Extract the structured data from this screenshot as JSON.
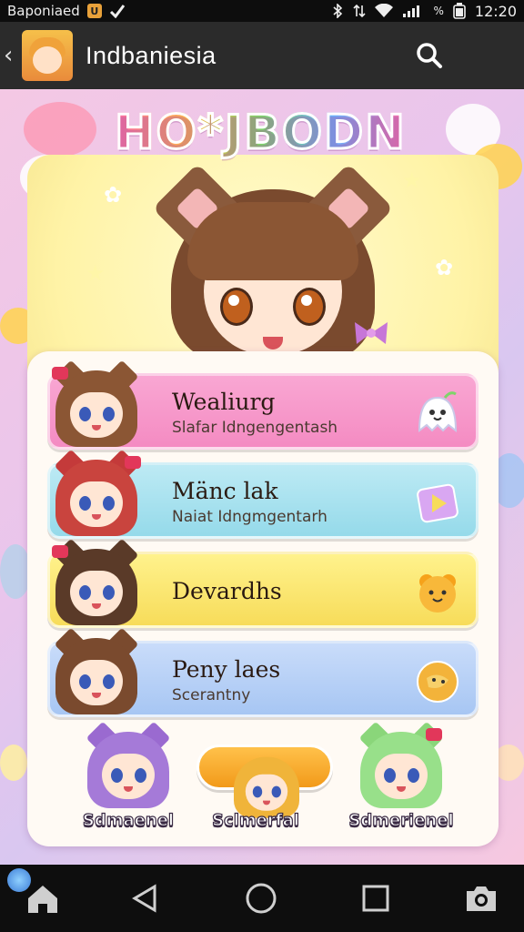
{
  "status_bar": {
    "app_name": "Baponiaed",
    "badge": "U",
    "time": "12:20",
    "battery": "%"
  },
  "app_bar": {
    "title": "Indbaniesia",
    "back_icon": "chevron-left-icon",
    "search_icon": "search-icon"
  },
  "hero": {
    "logo_text": "HO*JBODN"
  },
  "list": {
    "items": [
      {
        "title": "Wealiurg",
        "subtitle": "Slafar Idngengentash",
        "icon": "ghost-icon",
        "color": "#f48bc2"
      },
      {
        "title": "Mänc lak",
        "subtitle": "Naiat Idngmgentarh",
        "icon": "play-icon",
        "color": "#95daea"
      },
      {
        "title": "Devardhs",
        "subtitle": "",
        "icon": "bear-icon",
        "color": "#f7dc5a"
      },
      {
        "title": "Peny laes",
        "subtitle": "Scerantny",
        "icon": "cookie-icon",
        "color": "#a7c6f3"
      }
    ]
  },
  "bottom_characters": [
    {
      "label": "Sdmaenel"
    },
    {
      "label": "Sclmerfal"
    },
    {
      "label": "Sdmerienel"
    }
  ],
  "nav_bar": {
    "icons": [
      "home-icon",
      "back-icon",
      "home-circle-icon",
      "recents-icon",
      "camera-icon"
    ]
  }
}
